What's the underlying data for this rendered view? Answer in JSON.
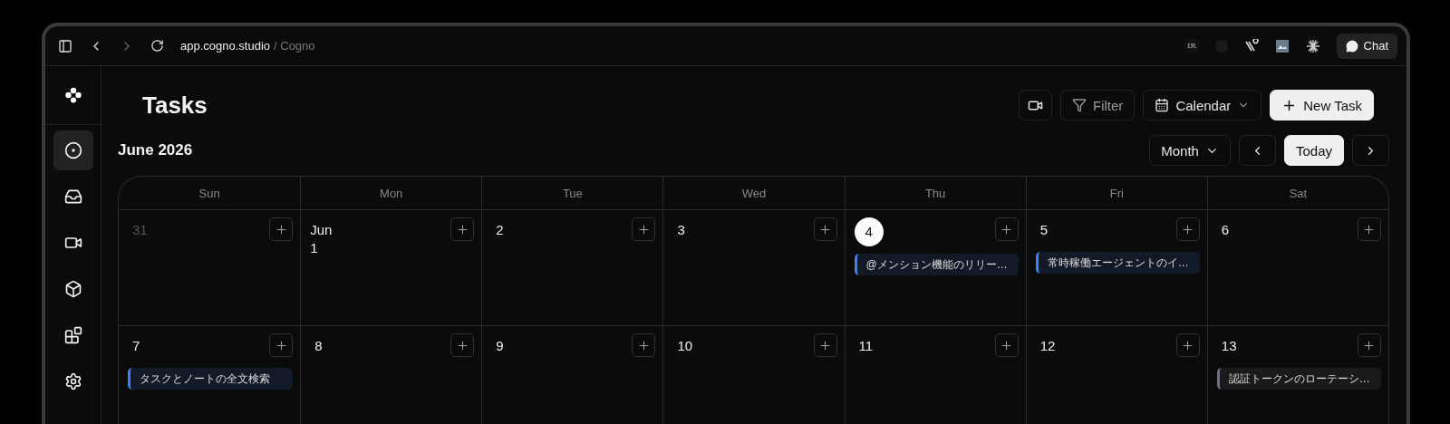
{
  "browser": {
    "url": "app.cogno.studio",
    "page_title": "/ Cogno",
    "extension_badge": "IR",
    "chat_button": "Chat"
  },
  "sidebar": {
    "items": [
      {
        "kind": "target",
        "selected": true
      },
      {
        "kind": "inbox",
        "selected": false
      },
      {
        "kind": "video",
        "selected": false
      },
      {
        "kind": "cube",
        "selected": false
      },
      {
        "kind": "apps",
        "selected": false
      },
      {
        "kind": "settings",
        "selected": false
      }
    ]
  },
  "header": {
    "title": "Tasks",
    "filter_button": "Filter",
    "view_dropdown": "Calendar",
    "new_task_button": "New Task"
  },
  "calendar": {
    "month_label": "June 2026",
    "range_dropdown": "Month",
    "today_button": "Today",
    "weekdays": [
      "Sun",
      "Mon",
      "Tue",
      "Wed",
      "Thu",
      "Fri",
      "Sat"
    ],
    "weeks": [
      [
        {
          "day": "31",
          "muted": true,
          "today": false
        },
        {
          "day": "Jun 1",
          "muted": false,
          "today": false
        },
        {
          "day": "2",
          "muted": false,
          "today": false
        },
        {
          "day": "3",
          "muted": false,
          "today": false
        },
        {
          "day": "4",
          "muted": false,
          "today": true,
          "events": [
            {
              "title": "@メンション機能のリリー…",
              "color": "#3b82f6"
            }
          ]
        },
        {
          "day": "5",
          "muted": false,
          "today": false,
          "events": [
            {
              "title": "常時稼働エージェントのイ…",
              "color": "#3b82f6"
            }
          ]
        },
        {
          "day": "6",
          "muted": false,
          "today": false
        }
      ],
      [
        {
          "day": "7",
          "muted": false,
          "today": false,
          "events": [
            {
              "title": "タスクとノートの全文検索",
              "color": "#3b82f6"
            }
          ]
        },
        {
          "day": "8",
          "muted": false,
          "today": false
        },
        {
          "day": "9",
          "muted": false,
          "today": false
        },
        {
          "day": "10",
          "muted": false,
          "today": false
        },
        {
          "day": "11",
          "muted": false,
          "today": false
        },
        {
          "day": "12",
          "muted": false,
          "today": false
        },
        {
          "day": "13",
          "muted": false,
          "today": false,
          "events": [
            {
              "title": "認証トークンのローテーシ…",
              "color": "#6b7280"
            }
          ]
        }
      ]
    ]
  }
}
